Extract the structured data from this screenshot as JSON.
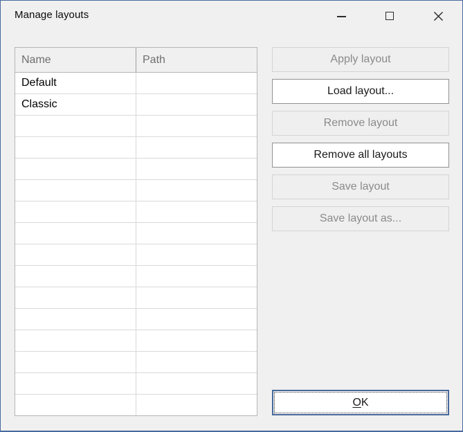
{
  "window": {
    "title": "Manage layouts"
  },
  "titlebar": {
    "controls": [
      "minimize",
      "maximize",
      "close"
    ]
  },
  "layout_table": {
    "columns": [
      "Name",
      "Path"
    ],
    "rows": [
      {
        "name": "Default",
        "path": ""
      },
      {
        "name": "Classic",
        "path": ""
      }
    ],
    "visible_row_count": 16
  },
  "action_buttons": [
    {
      "label": "Apply layout",
      "enabled": false
    },
    {
      "label": "Load layout...",
      "enabled": true
    },
    {
      "label": "Remove layout",
      "enabled": false
    },
    {
      "label": "Remove all layouts",
      "enabled": true
    },
    {
      "label": "Save layout",
      "enabled": false
    },
    {
      "label": "Save layout as...",
      "enabled": false
    }
  ],
  "ok_button": {
    "label": "OK",
    "mnemonic": "O",
    "label_rest": "K"
  },
  "colors": {
    "window_border": "#476a9e",
    "window_background": "#f0f0f0",
    "table_border": "#b5b5b5",
    "grid_line": "#d9d9d9",
    "header_text": "#6f6f6f",
    "enabled_button_border": "#919191",
    "disabled_button_background": "#efefef",
    "disabled_button_text": "#8a8a8a",
    "ok_focus_border": "#46689b"
  }
}
